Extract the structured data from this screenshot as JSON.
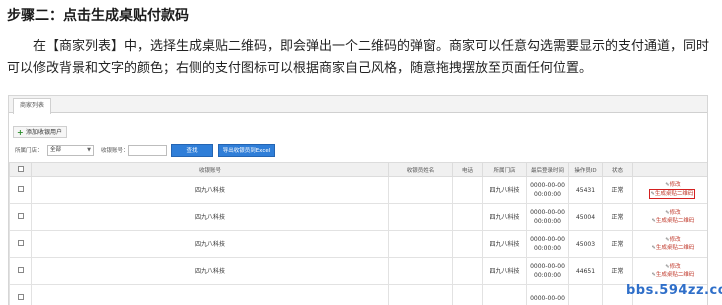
{
  "step_title": "步骤二：点击生成桌贴付款码",
  "description": "在【商家列表】中，选择生成桌贴二维码，即会弹出一个二维码的弹窗。商家可以任意勾选需要显示的支付通道，同时可以修改背景和文字的颜色；右侧的支付图标可以根据商家自己风格，随意拖拽摆放至页面任何位置。",
  "tab": "商家列表",
  "add_button": "添加收银用户",
  "filters": {
    "store_label": "所属门店：",
    "store_value": "全部",
    "account_label": "收银账号：",
    "account_value": "",
    "search_button": "查找",
    "export_button": "导出收银员到Excel"
  },
  "columns": [
    "",
    "收银账号",
    "收银员姓名",
    "电话",
    "所属门店",
    "最后登录时间",
    "操作员ID",
    "状态",
    ""
  ],
  "rows": [
    {
      "account": "",
      "name": "四九八科技",
      "phone": "",
      "store": "四九八科技",
      "time1": "0000-00-00",
      "time2": "00:00:00",
      "id": "45431",
      "status": "正常",
      "edit": "修改",
      "qr": "生成桌贴二维码",
      "highlight": true
    },
    {
      "account": "",
      "name": "四九八科技",
      "phone": "",
      "store": "四九八科技",
      "time1": "0000-00-00",
      "time2": "00:00:00",
      "id": "45004",
      "status": "正常",
      "edit": "修改",
      "qr": "生成桌贴二维码",
      "highlight": false
    },
    {
      "account": "",
      "name": "四九八科技",
      "phone": "",
      "store": "四九八科技",
      "time1": "0000-00-00",
      "time2": "00:00:00",
      "id": "45003",
      "status": "正常",
      "edit": "修改",
      "qr": "生成桌贴二维码",
      "highlight": false
    },
    {
      "account": "",
      "name": "四九八科技",
      "phone": "",
      "store": "四九八科技",
      "time1": "0000-00-00",
      "time2": "00:00:00",
      "id": "44651",
      "status": "正常",
      "edit": "修改",
      "qr": "生成桌贴二维码",
      "highlight": false
    },
    {
      "account": "",
      "name": "",
      "phone": "",
      "store": "",
      "time1": "0000-00-00",
      "time2": "",
      "id": "",
      "status": "",
      "edit": "",
      "qr": "",
      "highlight": false
    }
  ],
  "watermark": "bbs.594zz.com",
  "colors": {
    "accent": "#2f7ed8",
    "highlight": "#d42020",
    "link": "#c0392b"
  }
}
